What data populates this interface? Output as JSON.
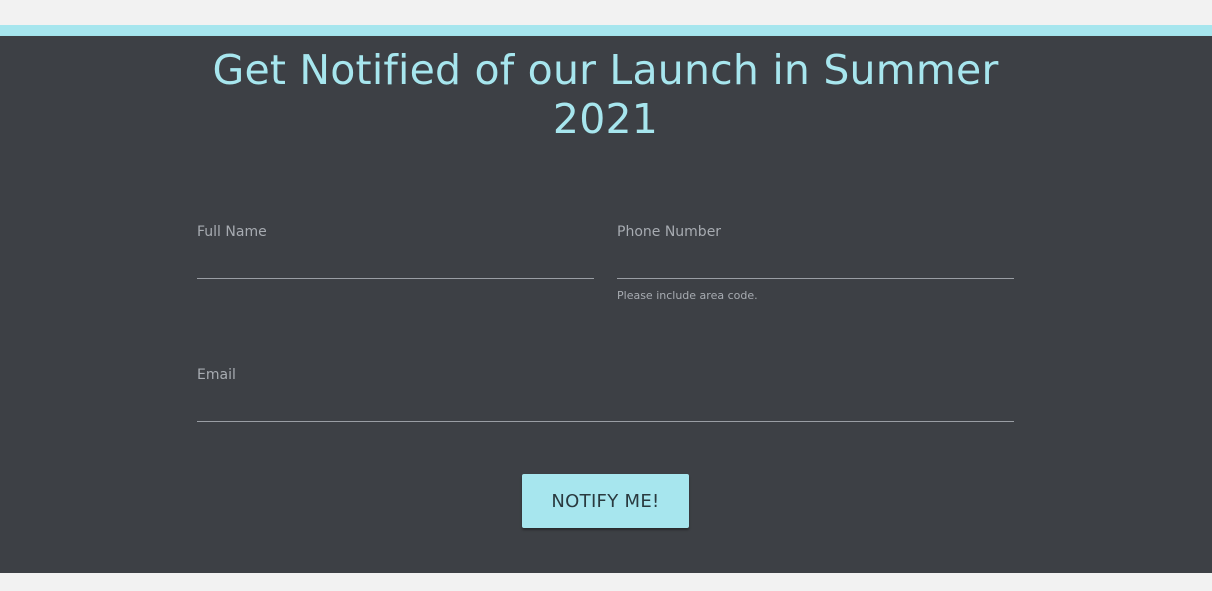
{
  "signup": {
    "title": "Get Notified of our Launch in Summer 2021",
    "fields": {
      "full_name": {
        "label": "Full Name",
        "value": ""
      },
      "phone": {
        "label": "Phone Number",
        "value": "",
        "hint": "Please include area code."
      },
      "email": {
        "label": "Email",
        "value": ""
      }
    },
    "submit_label": "NOTIFY ME!"
  },
  "colors": {
    "accent": "#a7e6ee",
    "panel_background": "#3d4045",
    "page_background": "#f2f2f2",
    "label_text": "#a7abb1"
  }
}
